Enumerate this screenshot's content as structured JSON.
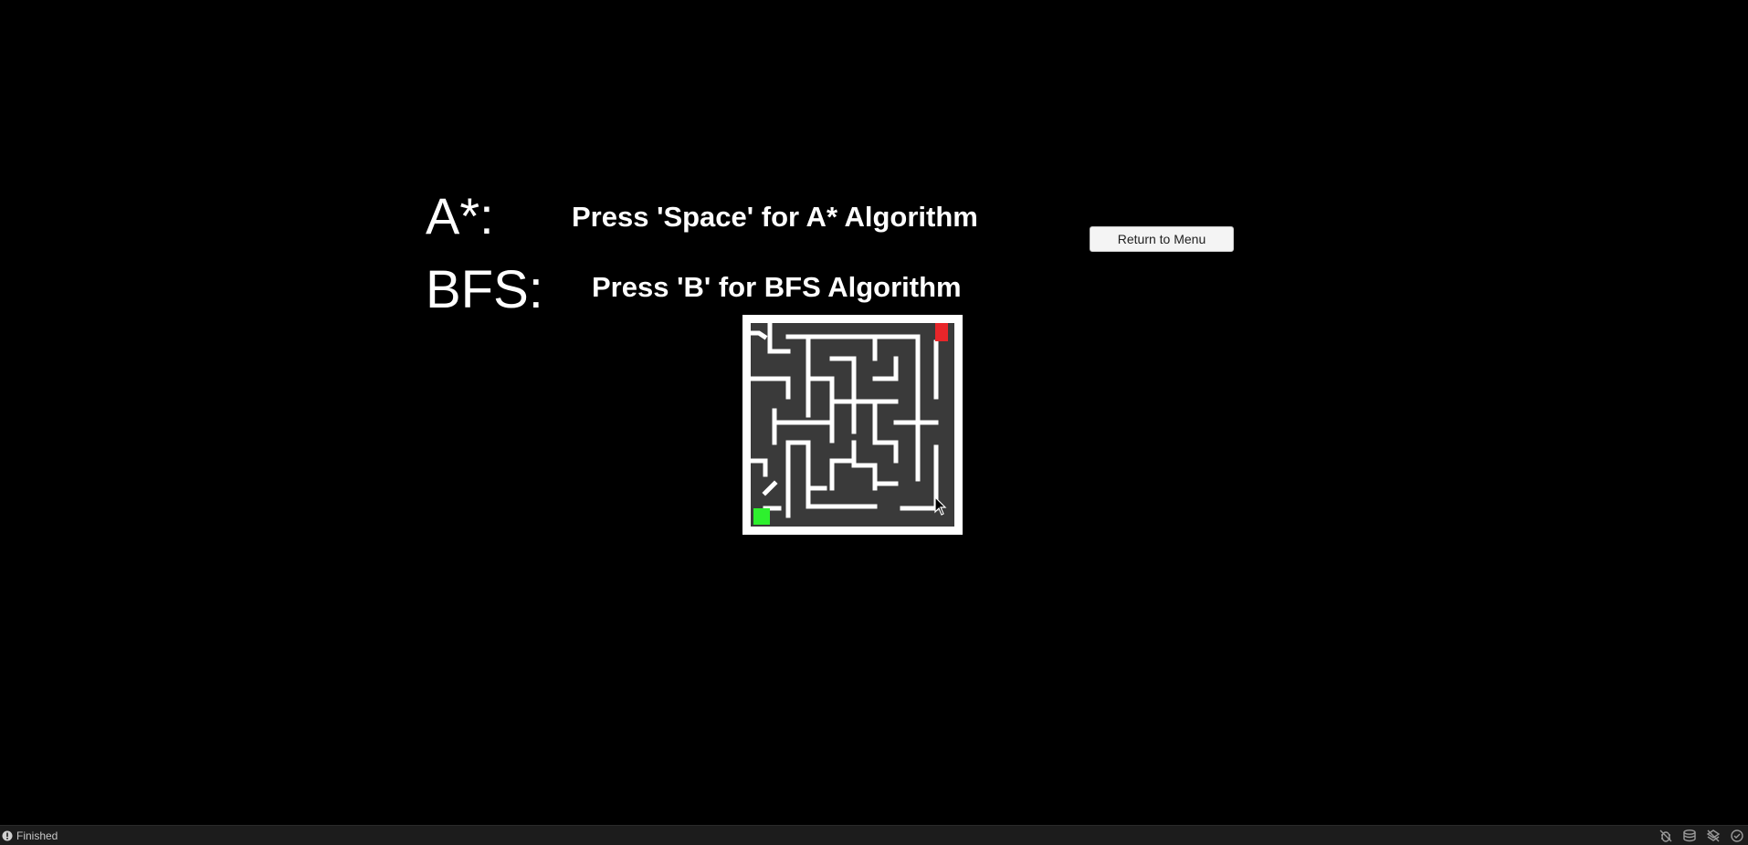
{
  "labels": {
    "astar": "A*:",
    "bfs": "BFS:"
  },
  "instructions": {
    "astar": "Press 'Space' for A* Algorithm",
    "bfs": "Press 'B' for BFS Algorithm"
  },
  "menu_button": {
    "label": "Return to Menu"
  },
  "maze": {
    "grid_size": 9,
    "wall_color": "#ffffff",
    "floor_color": "#3a3a3a",
    "start_color": "#2ef02e",
    "goal_color": "#e8262a"
  },
  "status_bar": {
    "text": "Finished",
    "icons": [
      "info-icon",
      "bug-off-icon",
      "stack-icon",
      "layers-off-icon",
      "check-circle-icon"
    ]
  }
}
